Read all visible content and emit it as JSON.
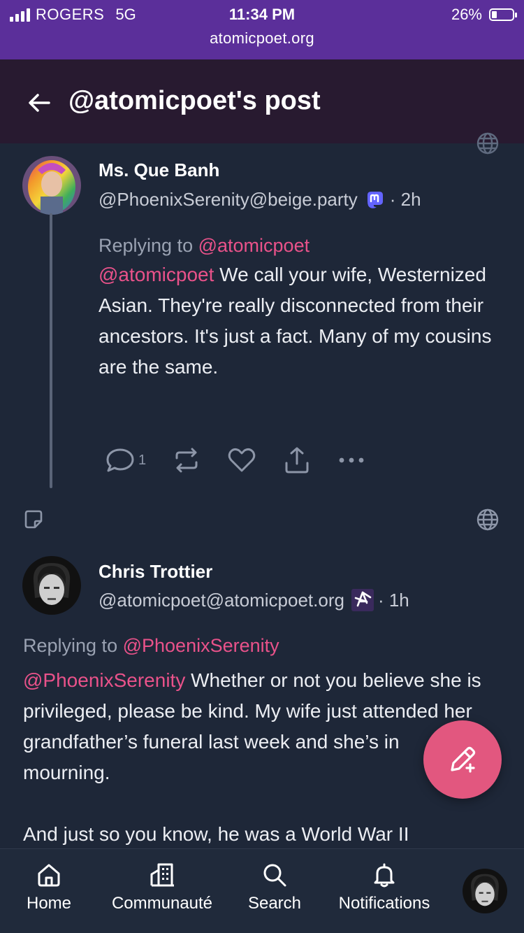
{
  "status_bar": {
    "carrier": "ROGERS",
    "network": "5G",
    "time": "11:34 PM",
    "url": "atomicpoet.org",
    "battery": "26%",
    "battery_level": 0.26
  },
  "header": {
    "title": "@atomicpoet's post"
  },
  "posts": [
    {
      "author": "Ms. Que Banh",
      "handle": "@PhoenixSerenity@beige.party",
      "time": "· 2h",
      "replying_label": "Replying to",
      "replying_to": "@atomicpoet",
      "mention": "@atomicpoet",
      "text": " We call your wife, Westernized Asian. They're really disconnected from their ancestors. It's just a fact. Many of my cousins are the same.",
      "reply_count": "1"
    },
    {
      "author": "Chris Trottier",
      "handle": "@atomicpoet@atomicpoet.org",
      "time": "· 1h",
      "replying_label": "Replying to",
      "replying_to": "@PhoenixSerenity",
      "mention": "@PhoenixSerenity",
      "text": " Whether or not you believe she is privileged, please be kind. My wife just attended her grandfather’s funeral last week and she’s in mourning.",
      "text2": "And just so you know, he was a World War II"
    }
  ],
  "nav": {
    "home": "Home",
    "community": "Communauté",
    "search": "Search",
    "notifications": "Notifications"
  },
  "colors": {
    "status_bar": "#5b2f9a",
    "header": "#281a30",
    "background": "#1e2738",
    "accent": "#e9528a",
    "fab": "#e2577f"
  },
  "icons": [
    "back-arrow-icon",
    "globe-icon",
    "mastodon-icon",
    "reply-icon",
    "boost-icon",
    "like-icon",
    "share-icon",
    "more-icon",
    "note-icon",
    "compose-icon",
    "home-icon",
    "community-icon",
    "search-icon",
    "bell-icon"
  ]
}
